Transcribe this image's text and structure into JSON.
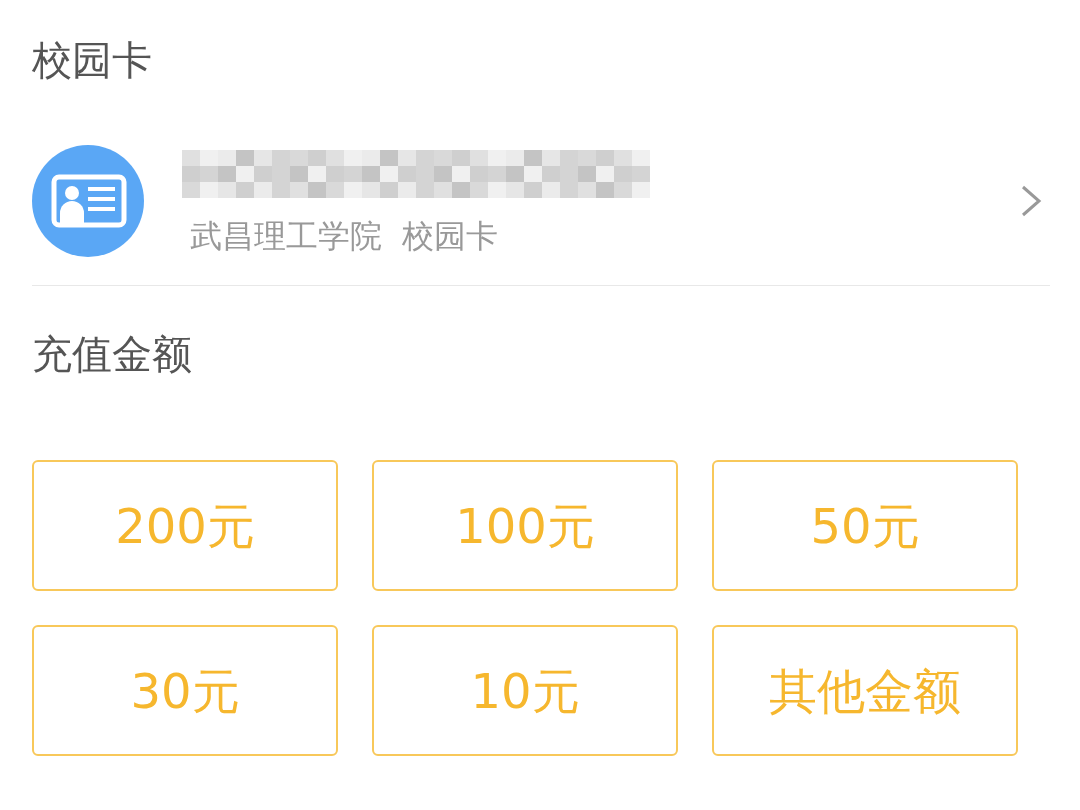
{
  "section_title": "校园卡",
  "card": {
    "name": {
      "kind": "redacted"
    },
    "subtitle": "武昌理工学院  校园卡"
  },
  "amount_title": "充值金额",
  "amounts": [
    {
      "label": "200元"
    },
    {
      "label": "100元"
    },
    {
      "label": "50元"
    },
    {
      "label": "30元"
    },
    {
      "label": "10元"
    },
    {
      "label": "其他金额"
    }
  ]
}
